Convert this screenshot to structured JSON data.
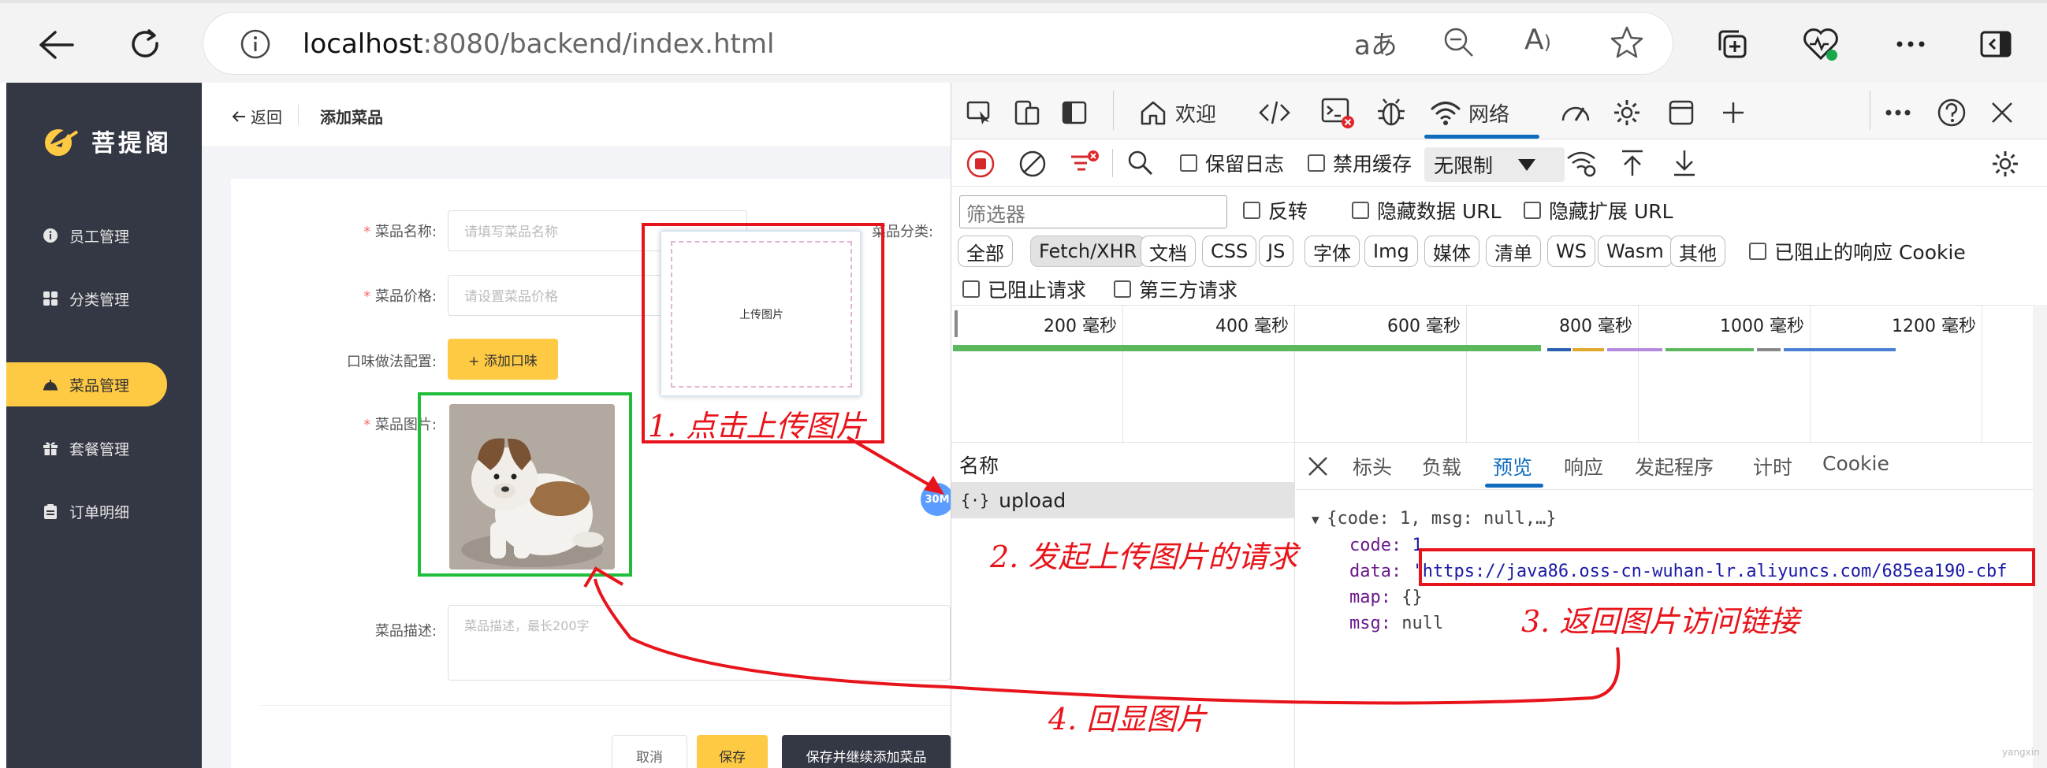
{
  "browser": {
    "url_host": "localhost",
    "url_rest": ":8080/backend/index.html"
  },
  "app": {
    "brand": "菩提阁",
    "back_label": "返回",
    "page_title": "添加菜品",
    "sidebar": [
      {
        "label": "员工管理",
        "icon": "info-icon"
      },
      {
        "label": "分类管理",
        "icon": "grid-icon"
      },
      {
        "label": "菜品管理",
        "icon": "dish-icon",
        "active": true
      },
      {
        "label": "套餐管理",
        "icon": "gift-icon"
      },
      {
        "label": "订单明细",
        "icon": "clipboard-icon"
      }
    ],
    "form": {
      "name_label": "菜品名称:",
      "name_placeholder": "请填写菜品名称",
      "category_label": "菜品分类:",
      "price_label": "菜品价格:",
      "price_placeholder": "请设置菜品价格",
      "flavor_label": "口味做法配置:",
      "add_flavor_button": "+ 添加口味",
      "image_label": "菜品图片:",
      "desc_label": "菜品描述:",
      "desc_placeholder": "菜品描述，最长200字",
      "cancel_button": "取消",
      "save_button": "保存",
      "save_continue_button": "保存并继续添加菜品"
    },
    "badge": "30M",
    "upload_popup_text": "上传图片"
  },
  "devtools": {
    "tabs": {
      "welcome": "欢迎",
      "network": "网络"
    },
    "toolbar": {
      "preserve_log": "保留日志",
      "disable_cache": "禁用缓存",
      "throttle": "无限制"
    },
    "filter": {
      "placeholder": "筛选器",
      "invert": "反转",
      "hide_data_url": "隐藏数据 URL",
      "hide_ext_url": "隐藏扩展 URL",
      "blocked_cookies": "已阻止的响应 Cookie",
      "blocked_requests": "已阻止请求",
      "third_party": "第三方请求",
      "types": [
        "全部",
        "Fetch/XHR",
        "文档",
        "CSS",
        "JS",
        "字体",
        "Img",
        "媒体",
        "清单",
        "WS",
        "Wasm",
        "其他"
      ]
    },
    "timeline_ticks": [
      "200 毫秒",
      "400 毫秒",
      "600 毫秒",
      "800 毫秒",
      "1000 毫秒",
      "1200 毫秒"
    ],
    "name_header": "名称",
    "request_name": "upload",
    "detail_tabs": [
      "标头",
      "负载",
      "预览",
      "响应",
      "发起程序",
      "计时",
      "Cookie"
    ],
    "preview": {
      "summary": "{code: 1, msg: null,…}",
      "code_key": "code:",
      "code_val": "1",
      "data_key": "data:",
      "data_val": "'https://java86.oss-cn-wuhan-lr.aliyuncs.com/685ea190-cbf",
      "map_key": "map:",
      "map_val": "{}",
      "msg_key": "msg:",
      "msg_val": "null"
    }
  },
  "annotations": {
    "step1": "1. 点击上传图片",
    "step2": "2. 发起上传图片的请求",
    "step3": "3. 返回图片访问链接",
    "step4": "4.   回显图片"
  },
  "watermark": "yangxin",
  "colors": {
    "accent": "#fec943",
    "sidebar": "#343744",
    "annotation_red": "#e8141b",
    "annotation_green": "#1fbd3a",
    "devtools_blue": "#0f6cbd"
  }
}
